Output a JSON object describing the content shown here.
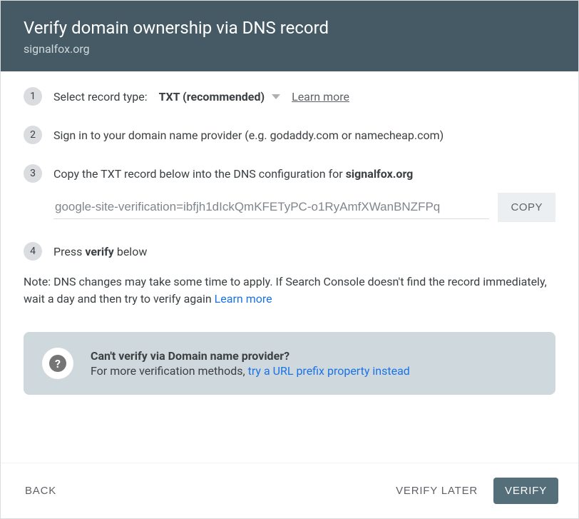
{
  "header": {
    "title": "Verify domain ownership via DNS record",
    "domain": "signalfox.org"
  },
  "step1": {
    "num": "1",
    "label": "Select record type:",
    "dropdown": "TXT (recommended)",
    "learn": "Learn more"
  },
  "step2": {
    "num": "2",
    "text": "Sign in to your domain name provider (e.g. godaddy.com or namecheap.com)"
  },
  "step3": {
    "num": "3",
    "prefix": "Copy the TXT record below into the DNS configuration for ",
    "domain": "signalfox.org",
    "record": "google-site-verification=ibfjh1dIckQmKFETyPC-o1RyAmfXWanBNZFPq",
    "copy": "COPY"
  },
  "step4": {
    "num": "4",
    "prefix": "Press ",
    "bold": "verify",
    "suffix": " below"
  },
  "note": {
    "text": "Note: DNS changes may take some time to apply. If Search Console doesn't find the record immediately, wait a day and then try to verify again ",
    "link": "Learn more"
  },
  "alt": {
    "title": "Can't verify via Domain name provider?",
    "lead": "For more verification methods, ",
    "link": "try a URL prefix property instead"
  },
  "footer": {
    "back": "BACK",
    "later": "VERIFY LATER",
    "verify": "VERIFY"
  }
}
